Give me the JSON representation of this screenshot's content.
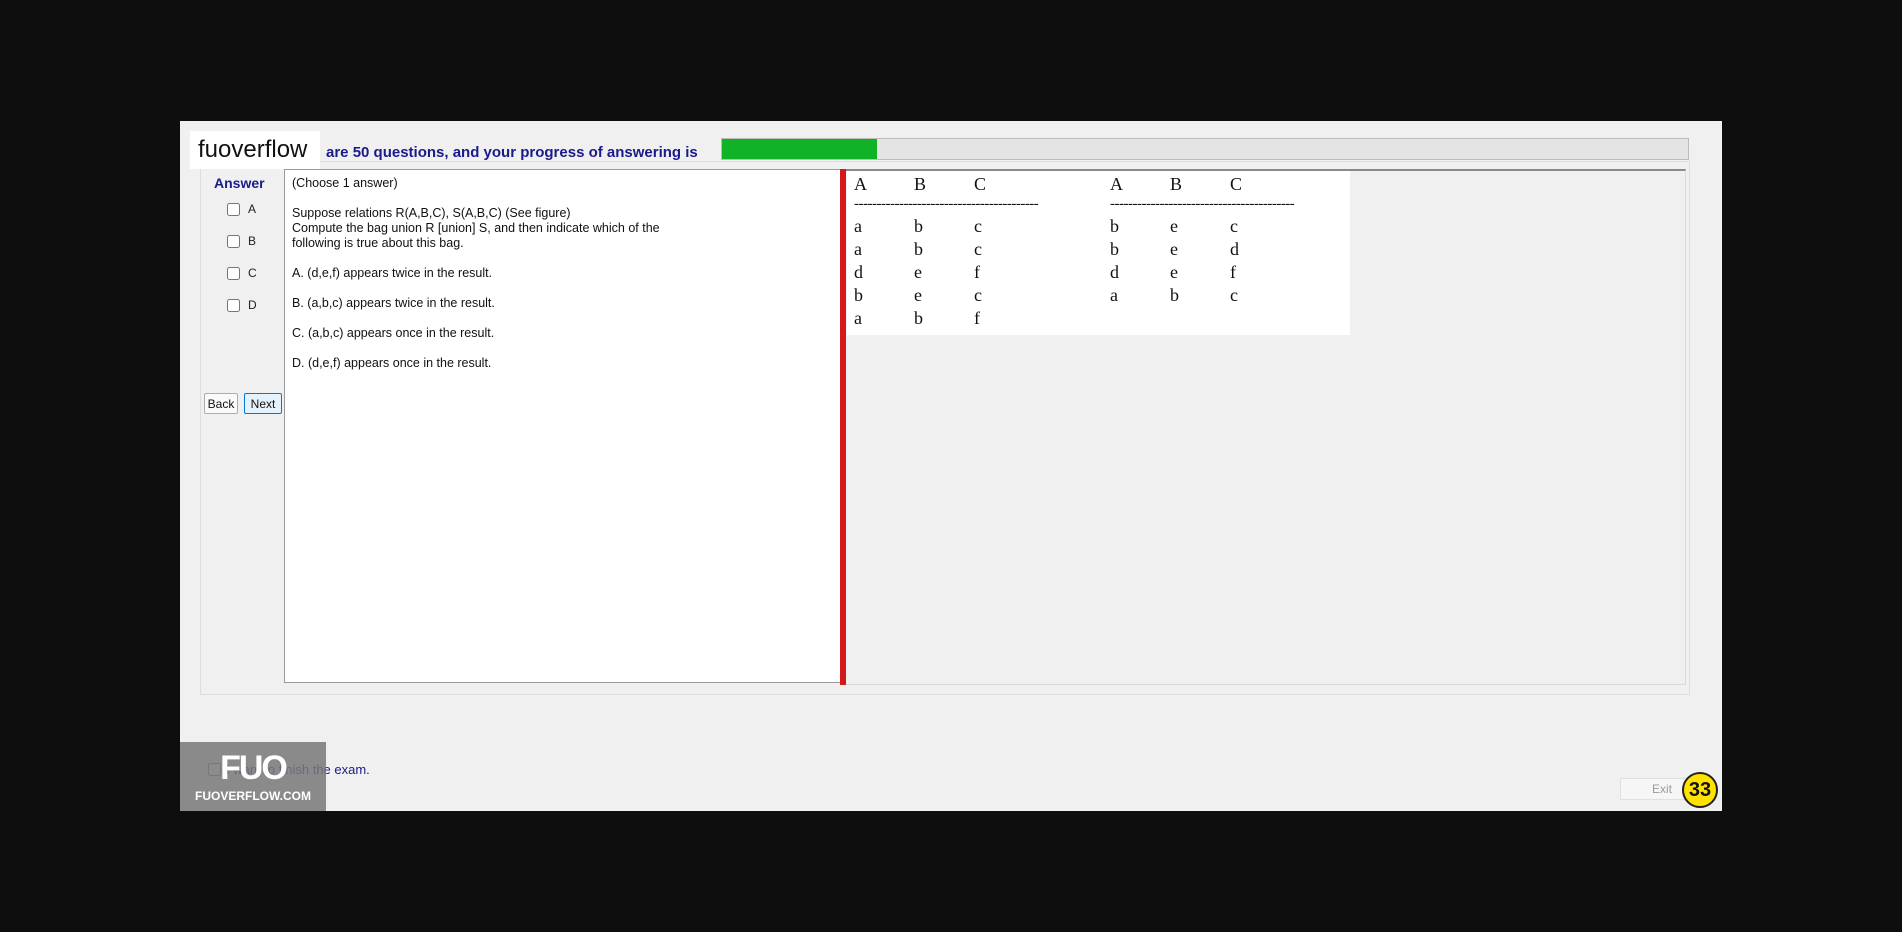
{
  "header": {
    "logo_text": "fuoverflow",
    "progress_text": "are 50 questions, and your progress of answering is",
    "progress_fraction": 0.16
  },
  "answer": {
    "title": "Answer",
    "options": [
      "A",
      "B",
      "C",
      "D"
    ]
  },
  "nav": {
    "back_label": "Back",
    "next_label": "Next"
  },
  "question": {
    "lines": [
      "(Choose 1 answer)",
      "Suppose relations R(A,B,C), S(A,B,C) (See figure)",
      "Compute the bag union R [union] S, and then indicate which of the",
      "following is true about this bag.",
      "A.  (d,e,f) appears twice in the result.",
      "B.  (a,b,c) appears twice in the result.",
      "C.  (a,b,c) appears once in the result.",
      "D.  (d,e,f) appears once in the result."
    ]
  },
  "figure": {
    "separator": "-----------------------------------------",
    "relation_r": {
      "headers": [
        "A",
        "B",
        "C"
      ],
      "rows": [
        [
          "a",
          "b",
          "c"
        ],
        [
          "a",
          "b",
          "c"
        ],
        [
          "d",
          "e",
          "f"
        ],
        [
          "b",
          "e",
          "c"
        ],
        [
          "a",
          "b",
          "f"
        ]
      ]
    },
    "relation_s": {
      "headers": [
        "A",
        "B",
        "C"
      ],
      "rows": [
        [
          "b",
          "e",
          "c"
        ],
        [
          "b",
          "e",
          "d"
        ],
        [
          "d",
          "e",
          "f"
        ],
        [
          "a",
          "b",
          "c"
        ]
      ]
    }
  },
  "footer": {
    "finish_label": "I want to finish the exam.",
    "watermark_big": "FUO",
    "watermark_small": "FUOVERFLOW.COM",
    "exit_label": "Exit",
    "badge_number": "33"
  },
  "colors": {
    "progress_fill": "#10b325",
    "heading_blue": "#1a1a8c",
    "divider_red": "#d21a1a",
    "badge_yellow": "#ffe200"
  }
}
